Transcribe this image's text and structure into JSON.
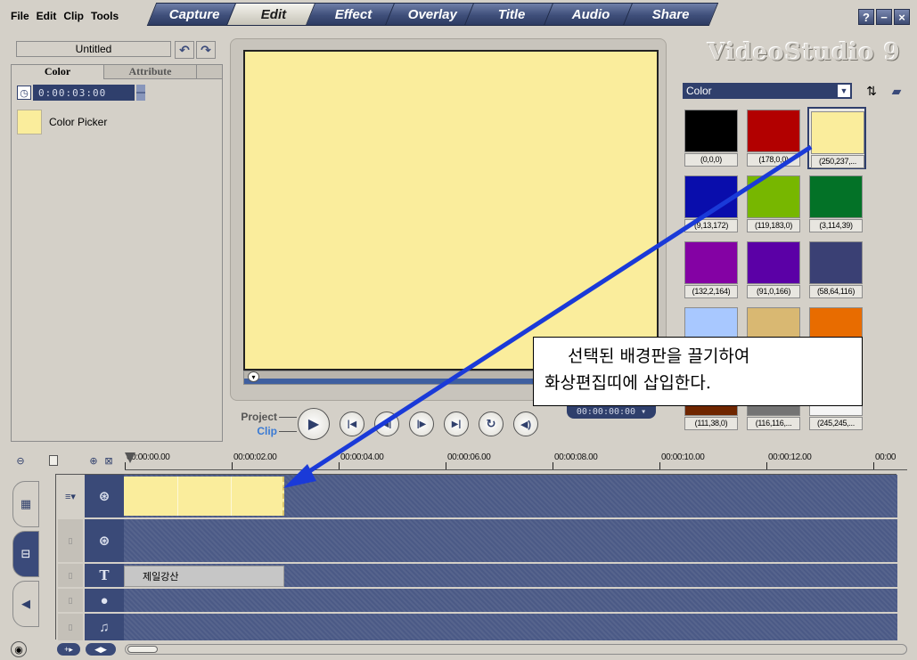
{
  "menu": [
    "File",
    "Edit",
    "Clip",
    "Tools"
  ],
  "tabs": [
    {
      "label": "Capture",
      "active": false
    },
    {
      "label": "Edit",
      "active": true
    },
    {
      "label": "Effect",
      "active": false
    },
    {
      "label": "Overlay",
      "active": false
    },
    {
      "label": "Title",
      "active": false
    },
    {
      "label": "Audio",
      "active": false
    },
    {
      "label": "Share",
      "active": false
    }
  ],
  "window_buttons": [
    "?",
    "−",
    "×"
  ],
  "project": {
    "name": "Untitled"
  },
  "options": {
    "tabs": [
      "Color",
      "Attribute"
    ],
    "duration": "0:00:03:00",
    "color_picker_label": "Color Picker",
    "color_picker_value": "#faed9c"
  },
  "preview": {
    "project_label": "Project",
    "clip_label": "Clip",
    "timecode": "00:00:00:00",
    "screen_color": "#faed9c"
  },
  "library": {
    "logo": "VideoStudio 9",
    "category": "Color",
    "swatches": [
      {
        "color": "#000000",
        "label": "(0,0,0)"
      },
      {
        "color": "#b20000",
        "label": "(178,0,0)"
      },
      {
        "color": "#faed9c",
        "label": "(250,237,...",
        "selected": true
      },
      {
        "color": "#090dac",
        "label": "(9,13,172)"
      },
      {
        "color": "#77b700",
        "label": "(119,183,0)"
      },
      {
        "color": "#037227",
        "label": "(3,114,39)"
      },
      {
        "color": "#8402a4",
        "label": "(132,2,164)"
      },
      {
        "color": "#5b00a6",
        "label": "(91,0,166)"
      },
      {
        "color": "#3a4074",
        "label": "(58,64,116)"
      },
      {
        "color": "#a8c8ff",
        "label": ""
      },
      {
        "color": "#d9b872",
        "label": ""
      },
      {
        "color": "#e86c00",
        "label": ")"
      },
      {
        "color": "#6f2600",
        "label": "(111,38,0)"
      },
      {
        "color": "#747474",
        "label": "(116,116,..."
      },
      {
        "color": "#f5f5f5",
        "label": "(245,245,..."
      }
    ]
  },
  "callout": {
    "line1": "선택된 배경판을 끌기하여",
    "line2": "화상편집띠에 삽입한다."
  },
  "timeline": {
    "ruler": [
      "00:00:00.00",
      "00:00:02.00",
      "00:00:04.00",
      "00:00:06.00",
      "00:00:08.00",
      "00:00:10.00",
      "00:00:12.00",
      "00:00"
    ],
    "title_clip": "제일강산",
    "clip_color": "#faed9c"
  },
  "colors": {
    "accent": "#2f3f6c",
    "arrow": "#1a3ad8",
    "track": "#4b5a86"
  }
}
